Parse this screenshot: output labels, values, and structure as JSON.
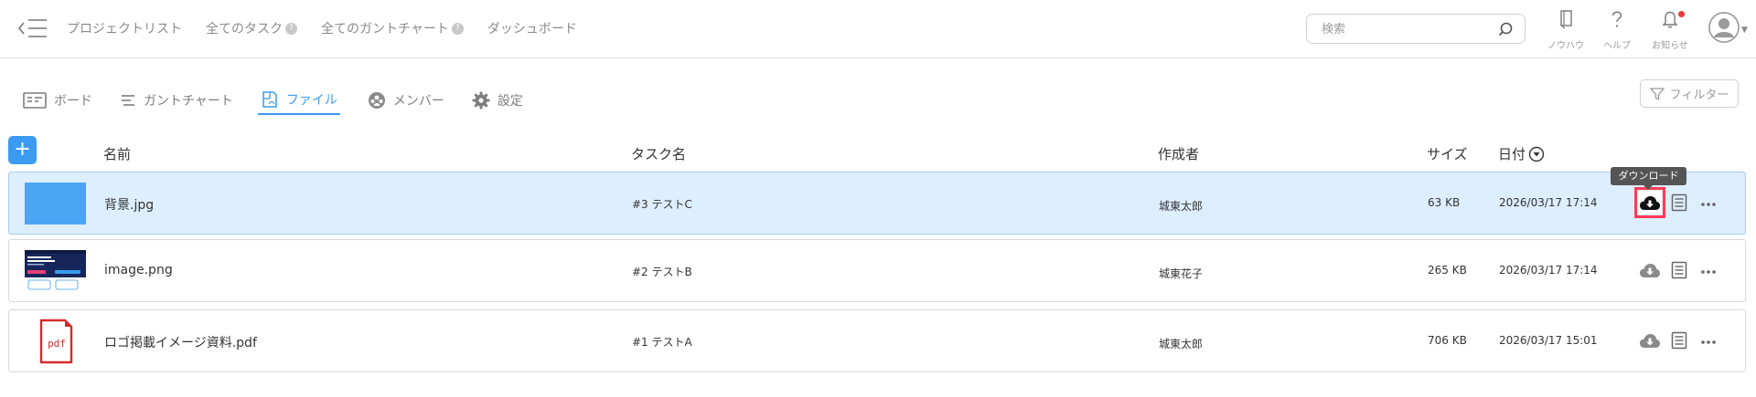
{
  "header": {
    "nav": [
      {
        "label": "プロジェクトリスト",
        "badge": ""
      },
      {
        "label": "全てのタスク",
        "badge": "?"
      },
      {
        "label": "全てのガントチャート",
        "badge": "?"
      },
      {
        "label": "ダッシュボード",
        "badge": ""
      }
    ],
    "search_placeholder": "検索",
    "icons": [
      {
        "name": "knowhow",
        "label": "ノウハウ"
      },
      {
        "name": "help",
        "label": "ヘルプ"
      },
      {
        "name": "notification",
        "label": "お知らせ"
      }
    ]
  },
  "tabs": [
    {
      "label": "ボード",
      "icon": "board-icon",
      "active": false
    },
    {
      "label": "ガントチャート",
      "icon": "gantt-icon",
      "active": false
    },
    {
      "label": "ファイル",
      "icon": "file-icon",
      "active": true
    },
    {
      "label": "メンバー",
      "icon": "members-icon",
      "active": false
    },
    {
      "label": "設定",
      "icon": "gear-icon",
      "active": false
    }
  ],
  "filter_label": "フィルター",
  "table": {
    "add_label": "+",
    "headers": {
      "name": "名前",
      "task": "タスク名",
      "creator": "作成者",
      "size": "サイズ",
      "date": "日付"
    },
    "rows": [
      {
        "name": "背景.jpg",
        "task": "#3 テストC",
        "creator": "城東太郎",
        "size": "63 KB",
        "date": "2026/03/17 17:14",
        "thumb": "image-blue",
        "selected": true
      },
      {
        "name": "image.png",
        "task": "#2 テストB",
        "creator": "城東花子",
        "size": "265 KB",
        "date": "2026/03/17 17:14",
        "thumb": "screenshot",
        "selected": false
      },
      {
        "name": "ロゴ掲載イメージ資料.pdf",
        "task": "#1 テストA",
        "creator": "城東太郎",
        "size": "706 KB",
        "date": "2026/03/17 15:01",
        "thumb": "pdf",
        "thumb_label": "pdf",
        "selected": false
      }
    ]
  },
  "tooltip": "ダウンロード",
  "colors": {
    "accent": "#3a9bf0",
    "selected_row": "#ddeeff",
    "highlight": "#ff3b55",
    "pdf_red": "#d42b2b"
  }
}
